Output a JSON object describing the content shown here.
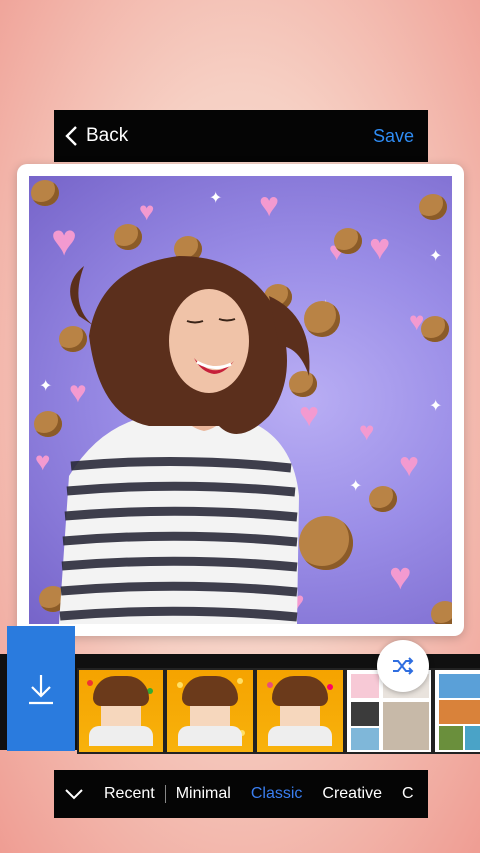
{
  "header": {
    "back_label": "Back",
    "save_label": "Save"
  },
  "icons": {
    "back": "chevron-left-icon",
    "download": "download-icon",
    "shuffle": "shuffle-icon",
    "expand": "chevron-down-icon"
  },
  "colors": {
    "accent": "#2f8cf3",
    "download_button": "#2a7bde",
    "active_tab": "#3a7ef0"
  },
  "categories": {
    "tabs": [
      {
        "label": "Recent"
      },
      {
        "label": "Minimal"
      },
      {
        "label": "Classic"
      },
      {
        "label": "Creative"
      },
      {
        "label": "C"
      }
    ],
    "selected": "Classic"
  }
}
